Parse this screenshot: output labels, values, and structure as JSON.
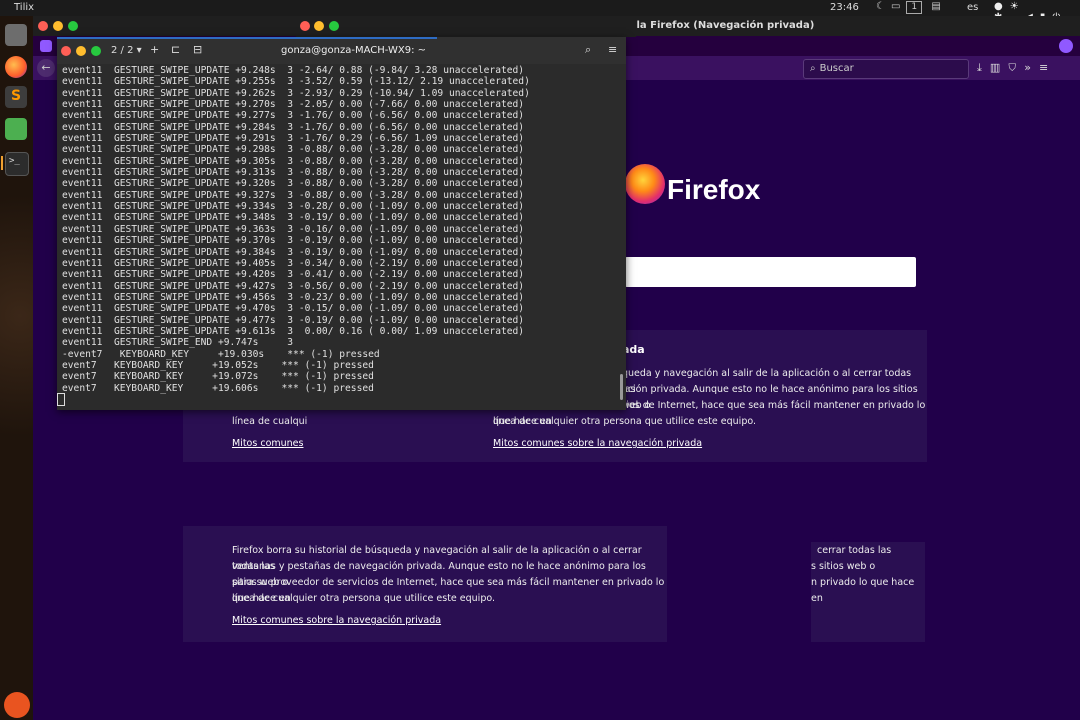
{
  "topbar": {
    "app_name": "Tilix",
    "clock": "23:46",
    "workspace": "1",
    "language": "es"
  },
  "firefox": {
    "window_title": "Mozilla Firefox (Navegación privada)",
    "search_placeholder": "Buscar",
    "logo_text": "Firefox",
    "private_title": "ada",
    "private_text_top": [
      "queda y navegación al salir de la aplicación o al cerrar todas las",
      "ación privada. Aunque esto no le hace anónimo para los sitios web o",
      "para su proveedor de servicios de Internet, hace que sea más fácil mantener en privado lo que hace en",
      "línea de cualquier otra persona que utilice este equipo."
    ],
    "private_text_left_fragments": [
      "para su proveedo",
      "línea de cualqui"
    ],
    "private_link_left_fragment": "Mitos comunes",
    "private_link": "Mitos comunes sobre la navegación privada",
    "private_text_bottom": [
      "Firefox borra su historial de búsqueda y navegación al salir de la aplicación o al cerrar todas las",
      "ventanas y pestañas de navegación privada. Aunque esto no le hace anónimo para los sitios web o",
      "para su proveedor de servicios de Internet, hace que sea más fácil mantener en privado lo que hace en",
      "línea de cualquier otra persona que utilice este equipo."
    ],
    "private_text_right_fragments": [
      "cerrar todas las",
      "s sitios web o",
      "n privado lo que hace en"
    ],
    "colors": {
      "background": "#21004a",
      "card": "#2a0f52",
      "accent": "#9059ff"
    }
  },
  "terminal": {
    "title": "gonza@gonza-MACH-WX9: ~",
    "page_indicator": "2 / 2",
    "lines": [
      "event11  GESTURE_SWIPE_UPDATE +9.248s  3 -2.64/ 0.88 (-9.84/ 3.28 unaccelerated)",
      "event11  GESTURE_SWIPE_UPDATE +9.255s  3 -3.52/ 0.59 (-13.12/ 2.19 unaccelerated)",
      "event11  GESTURE_SWIPE_UPDATE +9.262s  3 -2.93/ 0.29 (-10.94/ 1.09 unaccelerated)",
      "event11  GESTURE_SWIPE_UPDATE +9.270s  3 -2.05/ 0.00 (-7.66/ 0.00 unaccelerated)",
      "event11  GESTURE_SWIPE_UPDATE +9.277s  3 -1.76/ 0.00 (-6.56/ 0.00 unaccelerated)",
      "event11  GESTURE_SWIPE_UPDATE +9.284s  3 -1.76/ 0.00 (-6.56/ 0.00 unaccelerated)",
      "event11  GESTURE_SWIPE_UPDATE +9.291s  3 -1.76/ 0.29 (-6.56/ 1.09 unaccelerated)",
      "event11  GESTURE_SWIPE_UPDATE +9.298s  3 -0.88/ 0.00 (-3.28/ 0.00 unaccelerated)",
      "event11  GESTURE_SWIPE_UPDATE +9.305s  3 -0.88/ 0.00 (-3.28/ 0.00 unaccelerated)",
      "event11  GESTURE_SWIPE_UPDATE +9.313s  3 -0.88/ 0.00 (-3.28/ 0.00 unaccelerated)",
      "event11  GESTURE_SWIPE_UPDATE +9.320s  3 -0.88/ 0.00 (-3.28/ 0.00 unaccelerated)",
      "event11  GESTURE_SWIPE_UPDATE +9.327s  3 -0.88/ 0.00 (-3.28/ 0.00 unaccelerated)",
      "event11  GESTURE_SWIPE_UPDATE +9.334s  3 -0.28/ 0.00 (-1.09/ 0.00 unaccelerated)",
      "event11  GESTURE_SWIPE_UPDATE +9.348s  3 -0.19/ 0.00 (-1.09/ 0.00 unaccelerated)",
      "event11  GESTURE_SWIPE_UPDATE +9.363s  3 -0.16/ 0.00 (-1.09/ 0.00 unaccelerated)",
      "event11  GESTURE_SWIPE_UPDATE +9.370s  3 -0.19/ 0.00 (-1.09/ 0.00 unaccelerated)",
      "event11  GESTURE_SWIPE_UPDATE +9.384s  3 -0.19/ 0.00 (-1.09/ 0.00 unaccelerated)",
      "event11  GESTURE_SWIPE_UPDATE +9.405s  3 -0.34/ 0.00 (-2.19/ 0.00 unaccelerated)",
      "event11  GESTURE_SWIPE_UPDATE +9.420s  3 -0.41/ 0.00 (-2.19/ 0.00 unaccelerated)",
      "event11  GESTURE_SWIPE_UPDATE +9.427s  3 -0.56/ 0.00 (-2.19/ 0.00 unaccelerated)",
      "event11  GESTURE_SWIPE_UPDATE +9.456s  3 -0.23/ 0.00 (-1.09/ 0.00 unaccelerated)",
      "event11  GESTURE_SWIPE_UPDATE +9.470s  3 -0.15/ 0.00 (-1.09/ 0.00 unaccelerated)",
      "event11  GESTURE_SWIPE_UPDATE +9.477s  3 -0.19/ 0.00 (-1.09/ 0.00 unaccelerated)",
      "event11  GESTURE_SWIPE_UPDATE +9.613s  3  0.00/ 0.16 ( 0.00/ 1.09 unaccelerated)",
      "event11  GESTURE_SWIPE_END +9.747s     3",
      "-event7   KEYBOARD_KEY     +19.030s    *** (-1) pressed",
      "event7   KEYBOARD_KEY     +19.052s    *** (-1) pressed",
      "event7   KEYBOARD_KEY     +19.072s    *** (-1) pressed",
      "event7   KEYBOARD_KEY     +19.606s    *** (-1) pressed"
    ]
  }
}
